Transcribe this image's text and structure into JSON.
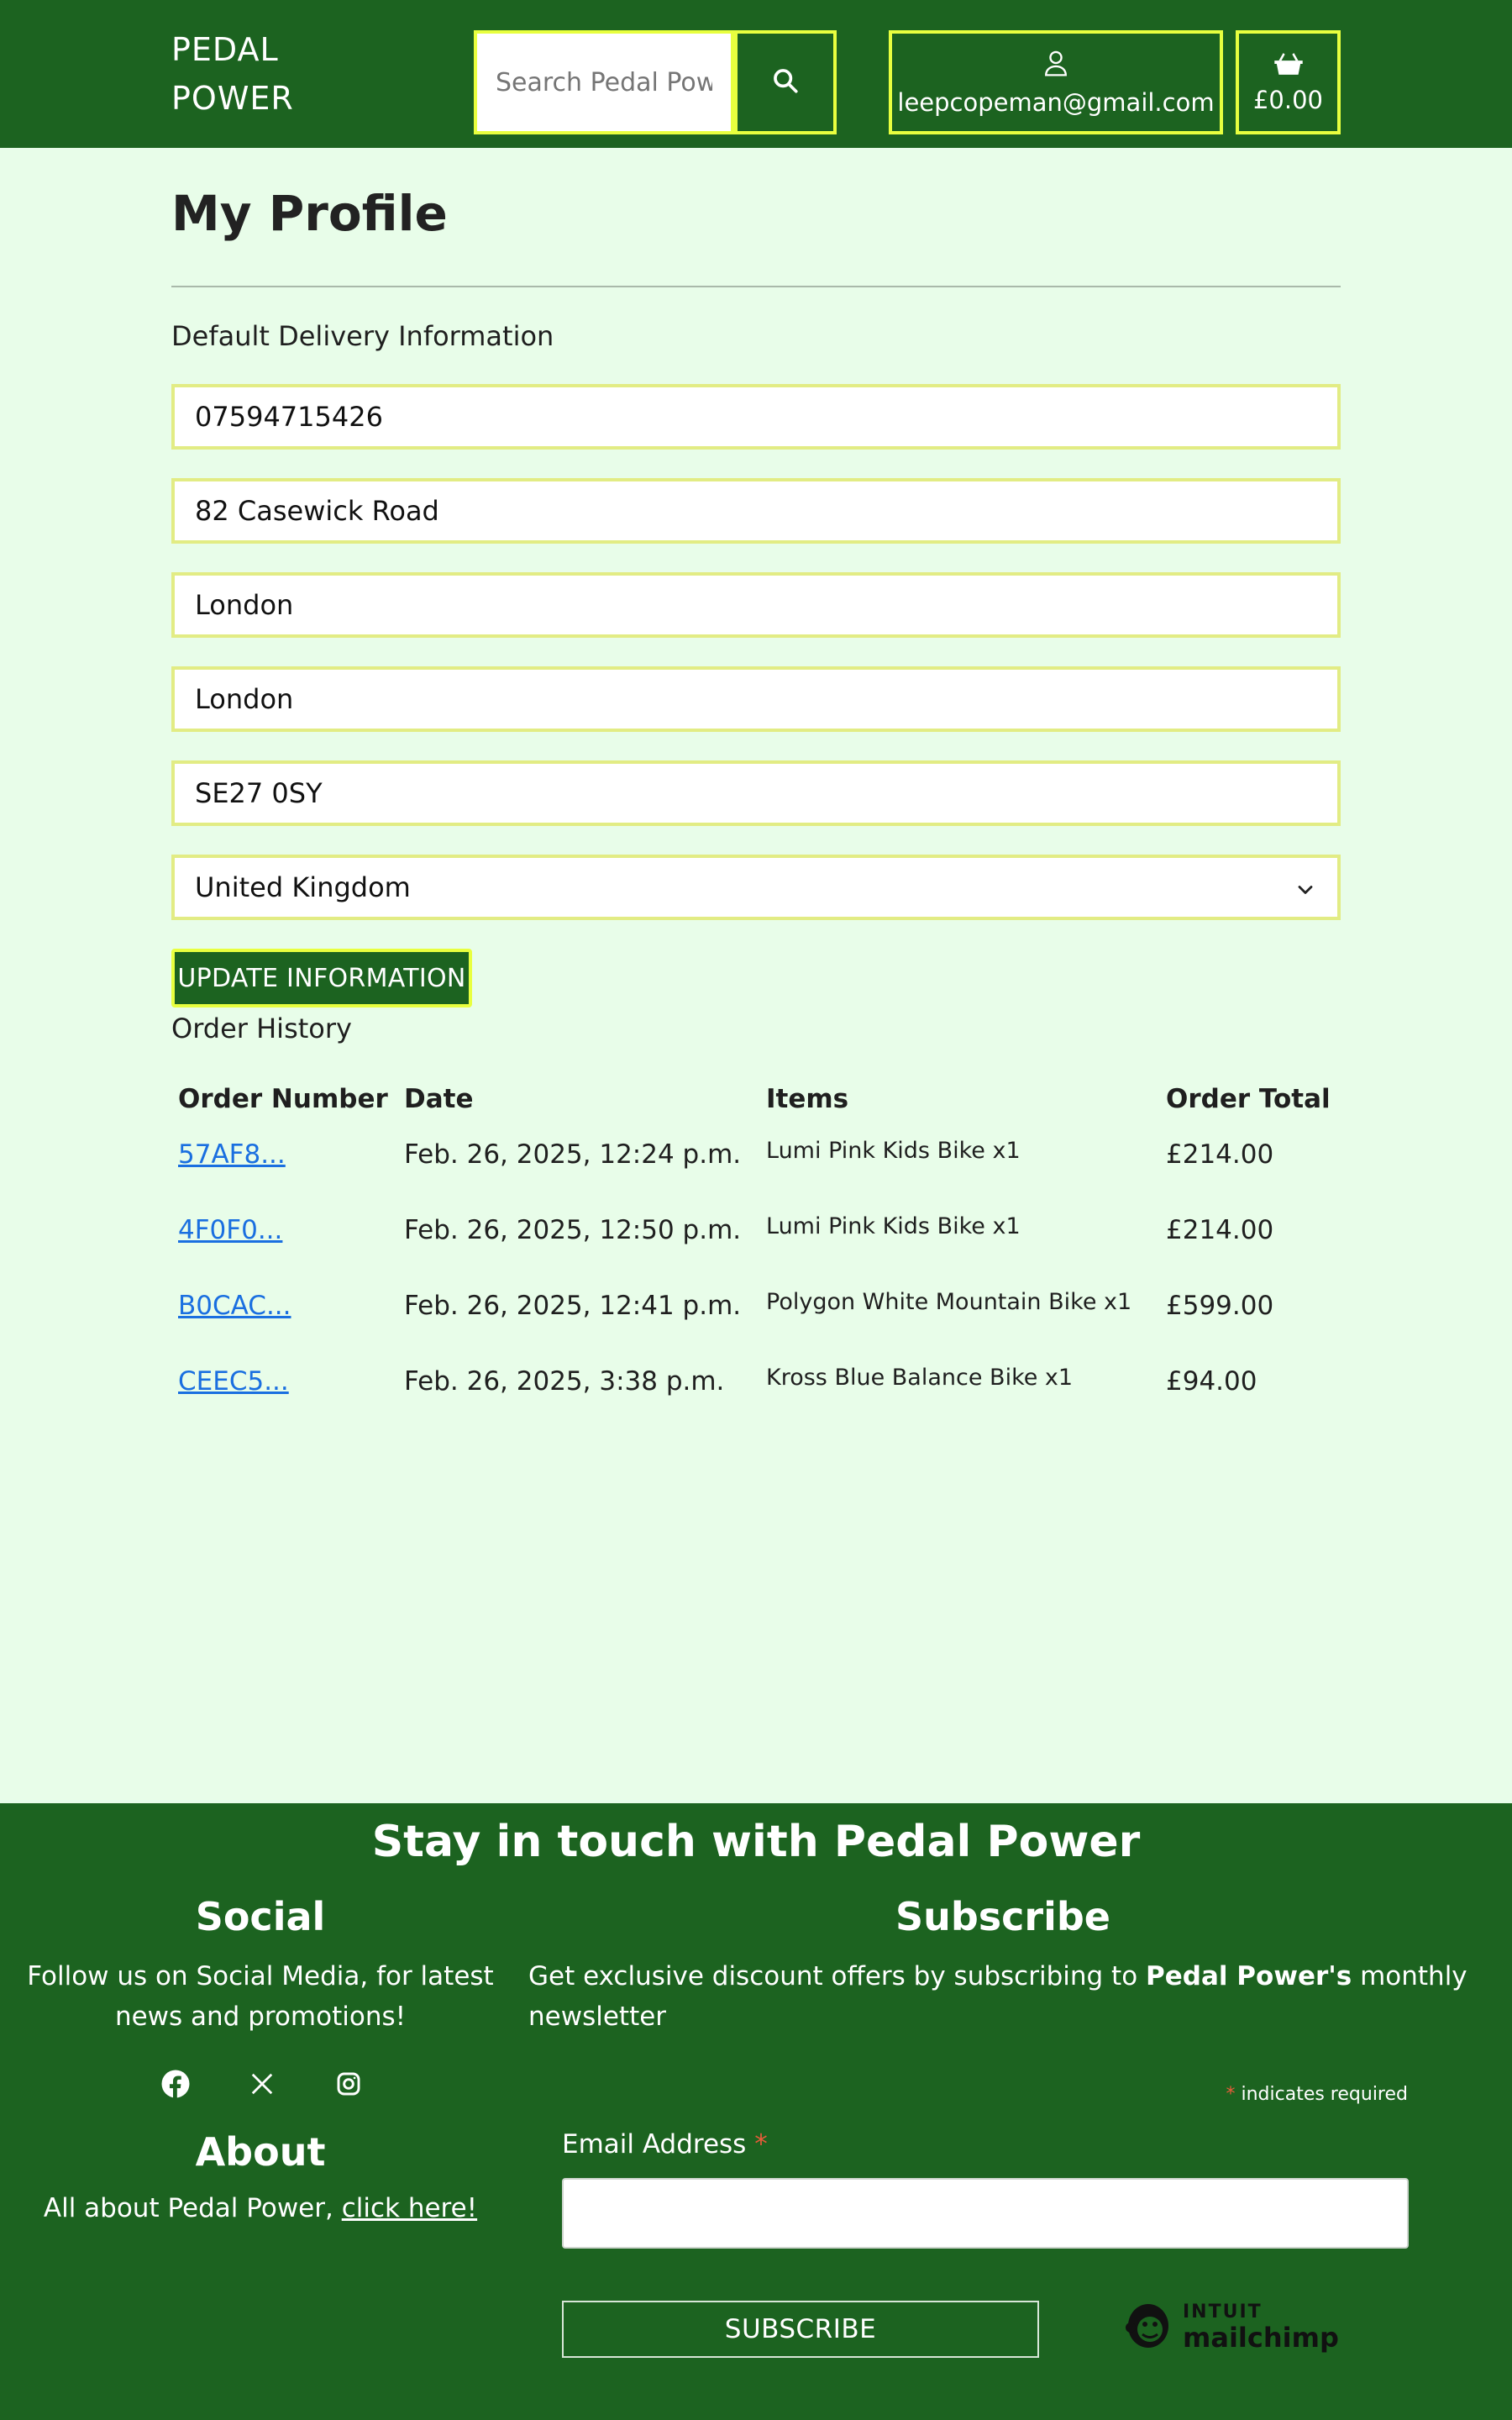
{
  "header": {
    "brand_line1": "PEDAL",
    "brand_line2": "POWER",
    "search_placeholder": "Search Pedal Power",
    "account_email": "leepcopeman@gmail.com",
    "cart_total": "£0.00"
  },
  "profile": {
    "title": "My Profile",
    "delivery_label": "Default Delivery Information",
    "fields": {
      "phone": "07594715426",
      "street": "82 Casewick Road",
      "town": "London",
      "county": "London",
      "postcode": "SE27 0SY",
      "country": "United Kingdom"
    },
    "update_button": "UPDATE INFORMATION"
  },
  "orders": {
    "title": "Order History",
    "headers": [
      "Order Number",
      "Date",
      "Items",
      "Order Total"
    ],
    "rows": [
      {
        "number": "57AF8...",
        "date": "Feb. 26, 2025, 12:24 p.m.",
        "items": "Lumi Pink Kids Bike x1",
        "total": "£214.00"
      },
      {
        "number": "4F0F0...",
        "date": "Feb. 26, 2025, 12:50 p.m.",
        "items": "Lumi Pink Kids Bike x1",
        "total": "£214.00"
      },
      {
        "number": "B0CAC...",
        "date": "Feb. 26, 2025, 12:41 p.m.",
        "items": "Polygon White Mountain Bike x1",
        "total": "£599.00"
      },
      {
        "number": "CEEC5...",
        "date": "Feb. 26, 2025, 3:38 p.m.",
        "items": "Kross Blue Balance Bike x1",
        "total": "£94.00"
      }
    ]
  },
  "footer": {
    "title": "Stay in touch with Pedal Power",
    "social_heading": "Social",
    "social_text_1": "Follow us on Social Media, for latest",
    "social_text_2": "news and promotions!",
    "social_icons": [
      "facebook-icon",
      "x-icon",
      "instagram-icon"
    ],
    "about_heading": "About",
    "about_text": "All about Pedal Power,",
    "about_link": "click here!",
    "subscribe_heading": "Subscribe",
    "subscribe_text_1": "Get exclusive discount offers by subscribing to",
    "subscribe_brand": "Pedal Power's",
    "subscribe_text_2": "monthly",
    "subscribe_text_3": "newsletter",
    "required_star": "*",
    "required_note": "indicates required",
    "email_label": "Email Address",
    "subscribe_button": "SUBSCRIBE",
    "mailchimp_line1": "INTUIT",
    "mailchimp_line2": "mailchimp"
  },
  "colors": {
    "header_bg": "#1c6320",
    "accent_border": "#e8ff3f",
    "page_bg": "#e8fde9",
    "link": "#1a6fe0"
  }
}
